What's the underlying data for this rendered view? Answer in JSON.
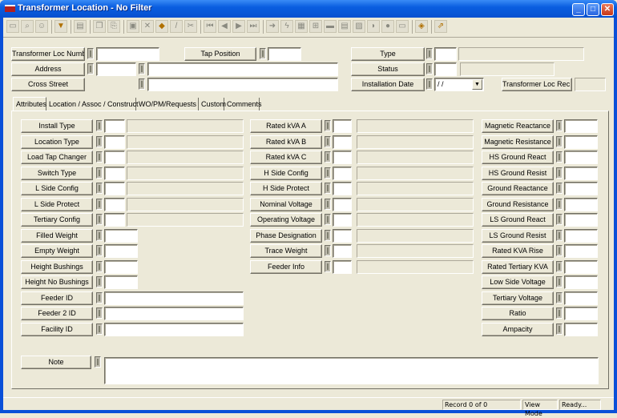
{
  "window": {
    "title": "Transformer Location - No Filter",
    "minimize": "_",
    "maximize": "□",
    "close": "✕"
  },
  "toolbar": {
    "icons": [
      "form-view-icon",
      "zoom-icon",
      "user-icon",
      "filter-icon",
      "report-icon",
      "copy-icon",
      "attach-icon",
      "save-icon",
      "delete-icon",
      "work-order-icon",
      "edit-icon",
      "cut-icon",
      "first-record-icon",
      "prev-record-icon",
      "next-record-icon",
      "last-record-icon",
      "goto-icon",
      "lightning-icon",
      "map-icon",
      "tree-icon",
      "list-icon",
      "print-icon",
      "chart-icon",
      "shape-icon",
      "globe-icon",
      "window-icon",
      "book-icon",
      "exit-icon"
    ]
  },
  "header": {
    "transformer_loc_number": {
      "label": "Transformer Loc Number",
      "value": ""
    },
    "tap_position": {
      "label": "Tap Position",
      "value": ""
    },
    "address": {
      "label": "Address",
      "value_num": "",
      "value_street": ""
    },
    "cross_street": {
      "label": "Cross Street",
      "value": ""
    },
    "type": {
      "label": "Type",
      "code": "",
      "desc": ""
    },
    "status": {
      "label": "Status",
      "code": "",
      "desc": ""
    },
    "installation_date": {
      "label": "Installation Date",
      "value": " / /"
    },
    "rec_number": {
      "label": "Transformer Loc Rec #",
      "value": ""
    }
  },
  "tabs": [
    "Attributes",
    "Location / Assoc / Construct",
    "WO/PM/Requests",
    "Custom",
    "Comments"
  ],
  "attributes": {
    "col1_coded": [
      "Install Type",
      "Location Type",
      "Load Tap Changer",
      "Switch Type",
      "L Side Config",
      "L Side Protect",
      "Tertiary Config"
    ],
    "col1_short": [
      "Filled Weight",
      "Empty Weight",
      "Height Bushings",
      "Height No Bushings"
    ],
    "col1_long": [
      "Feeder ID",
      "Feeder 2 ID",
      "Facility ID"
    ],
    "col2_coded": [
      "Rated kVA A",
      "Rated kVA B",
      "Rated kVA C",
      "H Side Config",
      "H Side Protect",
      "Nominal Voltage",
      "Operating Voltage",
      "Phase Designation",
      "Trace Weight",
      "Feeder Info"
    ],
    "col3": [
      "Magnetic Reactance",
      "Magnetic Resistance",
      "HS Ground React",
      "HS Ground Resist",
      "Ground Reactance",
      "Ground Resistance",
      "LS Ground React",
      "LS Ground Resist",
      "Rated KVA Rise",
      "Rated Tertiary KVA",
      "Low Side Voltage",
      "Tertiary Voltage",
      "Ratio",
      "Ampacity"
    ],
    "note_label": "Note",
    "note_value": ""
  },
  "statusbar": {
    "record": "Record 0 of 0",
    "mode": "View Mode",
    "state": "Ready..."
  }
}
